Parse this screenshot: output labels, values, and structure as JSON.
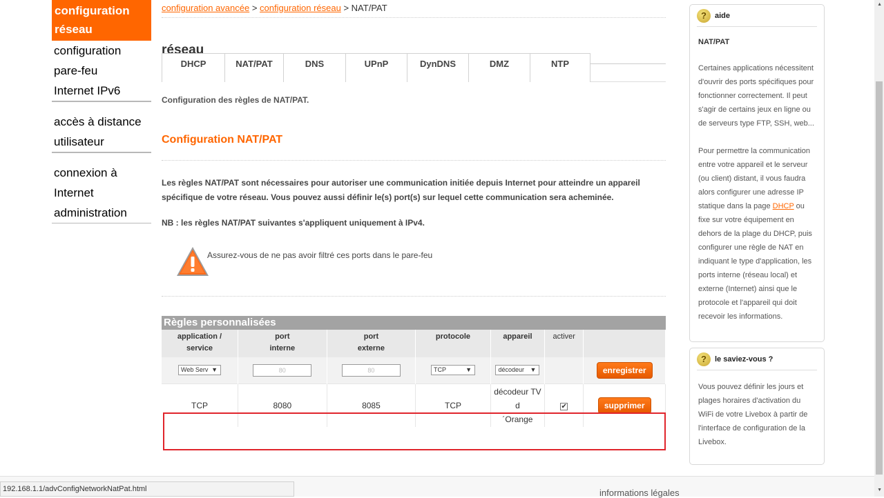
{
  "sidebar": {
    "active": {
      "line1": "configuration",
      "line2": "réseau"
    },
    "items": [
      {
        "label": "configuration"
      },
      {
        "label": "pare-feu"
      },
      {
        "label": "Internet IPv6"
      },
      {
        "label": "accès à distance"
      },
      {
        "label": "utilisateur"
      },
      {
        "label": "connexion à"
      },
      {
        "label": "Internet"
      },
      {
        "label": "administration"
      }
    ]
  },
  "breadcrumb": {
    "link1": "configuration avancée",
    "sep1": " > ",
    "link2": "configuration réseau",
    "sep2": " > ",
    "current": "NAT/PAT"
  },
  "page_title": "réseau",
  "tabs": [
    {
      "label": "DHCP"
    },
    {
      "label": "NAT/PAT"
    },
    {
      "label": "DNS"
    },
    {
      "label": "UPnP"
    },
    {
      "label": "DynDNS"
    },
    {
      "label": "DMZ"
    },
    {
      "label": "NTP"
    }
  ],
  "intro": "Configuration des règles de NAT/PAT.",
  "section_title": "Configuration NAT/PAT",
  "paragraph": "Les règles NAT/PAT sont nécessaires pour autoriser une communication initiée depuis Internet pour atteindre un appareil spécifique de votre réseau. Vous pouvez aussi définir le(s) port(s) sur lequel cette communication sera acheminée.",
  "note": "NB : les règles NAT/PAT suivantes s'appliquent uniquement à IPv4.",
  "warning": "Assurez-vous de ne pas avoir filtré ces ports dans le pare-feu",
  "rules": {
    "title": "Règles personnalisées",
    "headers": {
      "application_l1": "application /",
      "application_l2": "service",
      "internal_l1": "port",
      "internal_l2": "interne",
      "external_l1": "port",
      "external_l2": "externe",
      "protocol": "protocole",
      "device": "appareil",
      "enable": "activer"
    },
    "edit_row": {
      "service_value": "Web Serv",
      "internal_placeholder": "80",
      "external_placeholder": "80",
      "protocol_value": "TCP",
      "device_value": "décodeur",
      "save_label": "enregistrer"
    },
    "rule_row": {
      "service": "TCP",
      "internal_port": "8080",
      "external_port": "8085",
      "protocol": "TCP",
      "device_l1": "décodeur TV d",
      "device_l2": "´Orange",
      "enabled_mark": "✔",
      "delete_label": "supprimer"
    }
  },
  "help": {
    "head": "aide",
    "subtitle": "NAT/PAT",
    "p1": "Certaines applications nécessitent d'ouvrir des ports spécifiques pour fonctionner correctement. Il peut s'agir de certains jeux en ligne ou de serveurs type FTP, SSH, web...",
    "p2_before": "Pour permettre la communication entre votre appareil et le serveur (ou client) distant, il vous faudra alors configurer une adresse IP statique dans la page ",
    "p2_link": "DHCP",
    "p2_after": " ou fixe sur votre équipement en dehors de la plage du DHCP, puis configurer une règle de NAT en indiquant le type d'application, les ports interne (réseau local) et externe (Internet) ainsi que le protocole et l'appareil qui doit recevoir les informations."
  },
  "tip": {
    "head": "le saviez-vous ?",
    "body": "Vous pouvez définir les jours et plages horaires d'activation du WiFi de votre Livebox à partir de l'interface de configuration de la Livebox."
  },
  "status_bar": "192.168.1.1/advConfigNetworkNatPat.html",
  "footer": {
    "legal": "informations légales"
  },
  "colors": {
    "brand": "#ff6600",
    "highlight": "#e0242b"
  },
  "icons": {
    "help": "question-icon",
    "warning": "warning-triangle-icon",
    "dropdown": "dropdown-arrow-icon"
  }
}
